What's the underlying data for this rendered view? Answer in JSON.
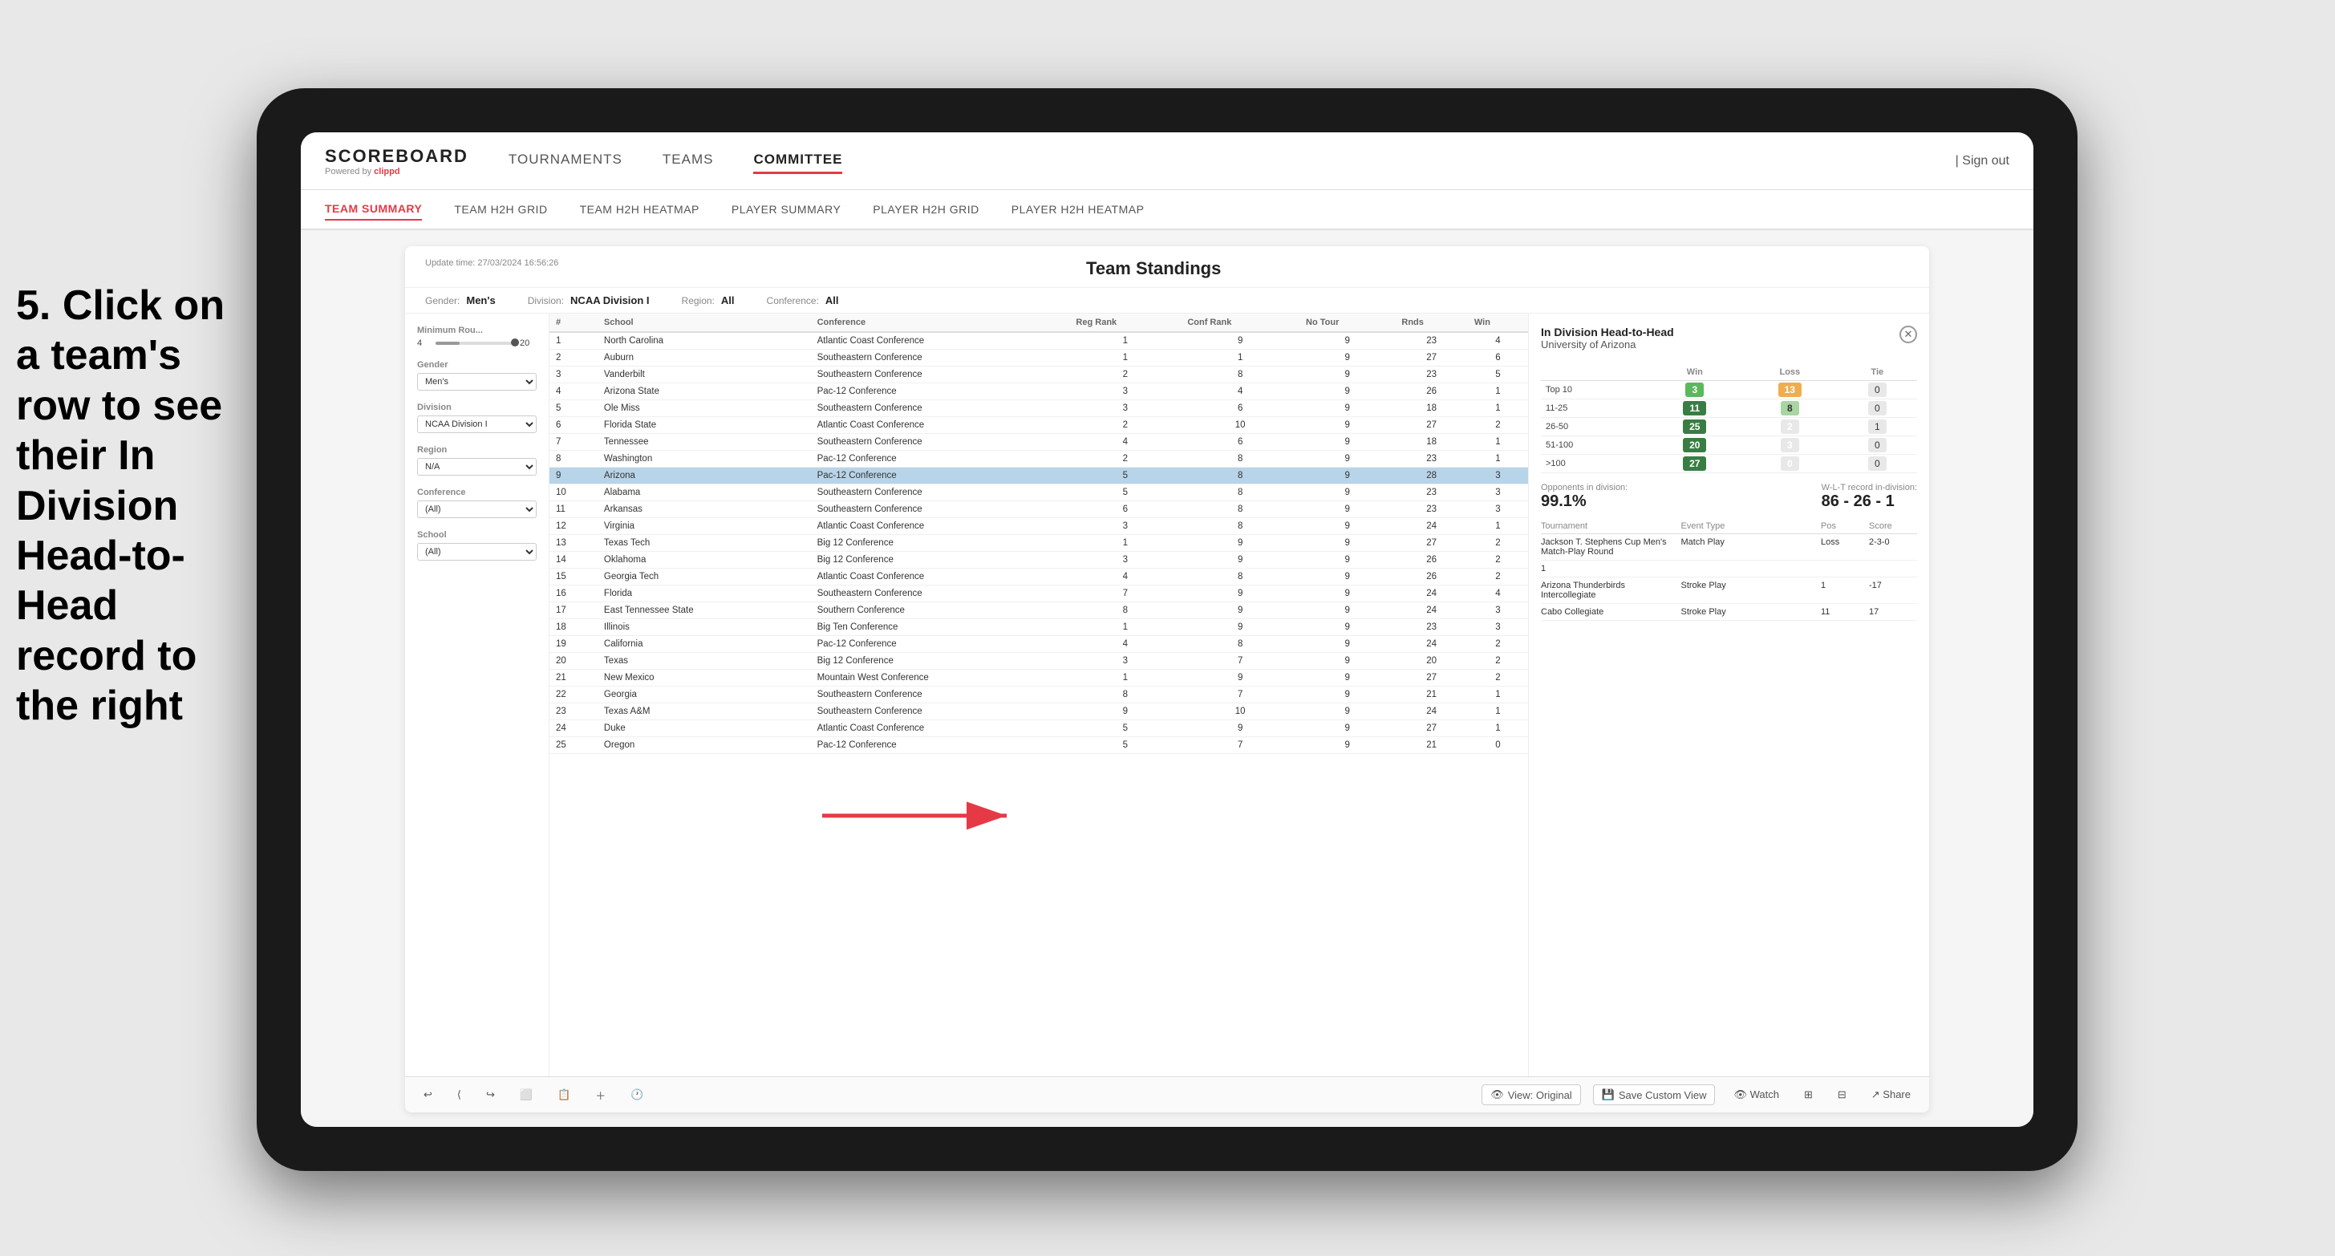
{
  "annotation": {
    "step": "5. Click on a team's row to see their In Division Head-to-Head record to the right"
  },
  "logo": {
    "title": "SCOREBOARD",
    "subtitle": "Powered by",
    "brand": "clippd"
  },
  "nav": {
    "items": [
      "TOURNAMENTS",
      "TEAMS",
      "COMMITTEE"
    ],
    "active": "COMMITTEE",
    "signOut": "Sign out"
  },
  "subNav": {
    "items": [
      "TEAM SUMMARY",
      "TEAM H2H GRID",
      "TEAM H2H HEATMAP",
      "PLAYER SUMMARY",
      "PLAYER H2H GRID",
      "PLAYER H2H HEATMAP"
    ],
    "active": "TEAM SUMMARY"
  },
  "panel": {
    "updateTime": "Update time: 27/03/2024 16:56:26",
    "title": "Team Standings",
    "filters": {
      "gender": {
        "label": "Gender:",
        "value": "Men's"
      },
      "division": {
        "label": "Division:",
        "value": "NCAA Division I"
      },
      "region": {
        "label": "Region:",
        "value": "All"
      },
      "conference": {
        "label": "Conference:",
        "value": "All"
      }
    }
  },
  "controls": {
    "minimumRounds": {
      "label": "Minimum Rou...",
      "min": "4",
      "max": "20"
    },
    "gender": {
      "label": "Gender",
      "value": "Men's"
    },
    "division": {
      "label": "Division",
      "value": "NCAA Division I"
    },
    "region": {
      "label": "Region",
      "value": "N/A"
    },
    "conference": {
      "label": "Conference",
      "value": "(All)"
    },
    "school": {
      "label": "School",
      "value": "(All)"
    }
  },
  "tableHeaders": [
    "#",
    "School",
    "Conference",
    "Reg Rank",
    "Conf Rank",
    "No Tour",
    "Rnds",
    "Win"
  ],
  "tableRows": [
    {
      "rank": "1",
      "school": "North Carolina",
      "conference": "Atlantic Coast Conference",
      "regRank": "1",
      "confRank": "9",
      "noTour": "9",
      "rnds": "23",
      "win": "4"
    },
    {
      "rank": "2",
      "school": "Auburn",
      "conference": "Southeastern Conference",
      "regRank": "1",
      "confRank": "1",
      "noTour": "9",
      "rnds": "27",
      "win": "6"
    },
    {
      "rank": "3",
      "school": "Vanderbilt",
      "conference": "Southeastern Conference",
      "regRank": "2",
      "confRank": "8",
      "noTour": "9",
      "rnds": "23",
      "win": "5"
    },
    {
      "rank": "4",
      "school": "Arizona State",
      "conference": "Pac-12 Conference",
      "regRank": "3",
      "confRank": "4",
      "noTour": "9",
      "rnds": "26",
      "win": "1"
    },
    {
      "rank": "5",
      "school": "Ole Miss",
      "conference": "Southeastern Conference",
      "regRank": "3",
      "confRank": "6",
      "noTour": "9",
      "rnds": "18",
      "win": "1"
    },
    {
      "rank": "6",
      "school": "Florida State",
      "conference": "Atlantic Coast Conference",
      "regRank": "2",
      "confRank": "10",
      "noTour": "9",
      "rnds": "27",
      "win": "2"
    },
    {
      "rank": "7",
      "school": "Tennessee",
      "conference": "Southeastern Conference",
      "regRank": "4",
      "confRank": "6",
      "noTour": "9",
      "rnds": "18",
      "win": "1"
    },
    {
      "rank": "8",
      "school": "Washington",
      "conference": "Pac-12 Conference",
      "regRank": "2",
      "confRank": "8",
      "noTour": "9",
      "rnds": "23",
      "win": "1"
    },
    {
      "rank": "9",
      "school": "Arizona",
      "conference": "Pac-12 Conference",
      "regRank": "5",
      "confRank": "8",
      "noTour": "9",
      "rnds": "28",
      "win": "3",
      "highlighted": true
    },
    {
      "rank": "10",
      "school": "Alabama",
      "conference": "Southeastern Conference",
      "regRank": "5",
      "confRank": "8",
      "noTour": "9",
      "rnds": "23",
      "win": "3"
    },
    {
      "rank": "11",
      "school": "Arkansas",
      "conference": "Southeastern Conference",
      "regRank": "6",
      "confRank": "8",
      "noTour": "9",
      "rnds": "23",
      "win": "3"
    },
    {
      "rank": "12",
      "school": "Virginia",
      "conference": "Atlantic Coast Conference",
      "regRank": "3",
      "confRank": "8",
      "noTour": "9",
      "rnds": "24",
      "win": "1"
    },
    {
      "rank": "13",
      "school": "Texas Tech",
      "conference": "Big 12 Conference",
      "regRank": "1",
      "confRank": "9",
      "noTour": "9",
      "rnds": "27",
      "win": "2"
    },
    {
      "rank": "14",
      "school": "Oklahoma",
      "conference": "Big 12 Conference",
      "regRank": "3",
      "confRank": "9",
      "noTour": "9",
      "rnds": "26",
      "win": "2"
    },
    {
      "rank": "15",
      "school": "Georgia Tech",
      "conference": "Atlantic Coast Conference",
      "regRank": "4",
      "confRank": "8",
      "noTour": "9",
      "rnds": "26",
      "win": "2"
    },
    {
      "rank": "16",
      "school": "Florida",
      "conference": "Southeastern Conference",
      "regRank": "7",
      "confRank": "9",
      "noTour": "9",
      "rnds": "24",
      "win": "4"
    },
    {
      "rank": "17",
      "school": "East Tennessee State",
      "conference": "Southern Conference",
      "regRank": "8",
      "confRank": "9",
      "noTour": "9",
      "rnds": "24",
      "win": "3"
    },
    {
      "rank": "18",
      "school": "Illinois",
      "conference": "Big Ten Conference",
      "regRank": "1",
      "confRank": "9",
      "noTour": "9",
      "rnds": "23",
      "win": "3"
    },
    {
      "rank": "19",
      "school": "California",
      "conference": "Pac-12 Conference",
      "regRank": "4",
      "confRank": "8",
      "noTour": "9",
      "rnds": "24",
      "win": "2"
    },
    {
      "rank": "20",
      "school": "Texas",
      "conference": "Big 12 Conference",
      "regRank": "3",
      "confRank": "7",
      "noTour": "9",
      "rnds": "20",
      "win": "2"
    },
    {
      "rank": "21",
      "school": "New Mexico",
      "conference": "Mountain West Conference",
      "regRank": "1",
      "confRank": "9",
      "noTour": "9",
      "rnds": "27",
      "win": "2"
    },
    {
      "rank": "22",
      "school": "Georgia",
      "conference": "Southeastern Conference",
      "regRank": "8",
      "confRank": "7",
      "noTour": "9",
      "rnds": "21",
      "win": "1"
    },
    {
      "rank": "23",
      "school": "Texas A&M",
      "conference": "Southeastern Conference",
      "regRank": "9",
      "confRank": "10",
      "noTour": "9",
      "rnds": "24",
      "win": "1"
    },
    {
      "rank": "24",
      "school": "Duke",
      "conference": "Atlantic Coast Conference",
      "regRank": "5",
      "confRank": "9",
      "noTour": "9",
      "rnds": "27",
      "win": "1"
    },
    {
      "rank": "25",
      "school": "Oregon",
      "conference": "Pac-12 Conference",
      "regRank": "5",
      "confRank": "7",
      "noTour": "9",
      "rnds": "21",
      "win": "0"
    }
  ],
  "h2h": {
    "title": "In Division Head-to-Head",
    "team": "University of Arizona",
    "tableHeaders": [
      "",
      "Win",
      "Loss",
      "Tie"
    ],
    "rows": [
      {
        "label": "Top 10",
        "win": "3",
        "loss": "13",
        "tie": "0",
        "winColor": "green",
        "lossColor": "orange"
      },
      {
        "label": "11-25",
        "win": "11",
        "loss": "8",
        "tie": "0",
        "winColor": "darkgreen",
        "lossColor": "lightgreen"
      },
      {
        "label": "26-50",
        "win": "25",
        "loss": "2",
        "tie": "1",
        "winColor": "darkgreen",
        "lossColor": "zero"
      },
      {
        "label": "51-100",
        "win": "20",
        "loss": "3",
        "tie": "0",
        "winColor": "darkgreen",
        "lossColor": "zero"
      },
      {
        "label": ">100",
        "win": "27",
        "loss": "0",
        "tie": "0",
        "winColor": "darkgreen",
        "lossColor": "zero"
      }
    ],
    "opponents": {
      "label": "Opponents in division:",
      "pct": "99.1%",
      "recordLabel": "W-L-T record in-division:",
      "record": "86 - 26 - 1"
    },
    "tournaments": [
      {
        "name": "Jackson T. Stephens Cup Men's Match-Play Round",
        "type": "Match Play",
        "result": "Loss",
        "score": "2-3-0"
      },
      {
        "name": "1",
        "type": "",
        "result": "",
        "score": ""
      },
      {
        "name": "Arizona Thunderbirds Intercollegiate",
        "type": "Stroke Play",
        "result": "1",
        "score": "-17"
      },
      {
        "name": "Cabo Collegiate",
        "type": "Stroke Play",
        "result": "11",
        "score": "17"
      }
    ]
  },
  "toolbar": {
    "undoLabel": "↩",
    "redoLabel": "↪",
    "viewOriginal": "View: Original",
    "saveCustomView": "Save Custom View",
    "watch": "Watch",
    "share": "Share"
  }
}
